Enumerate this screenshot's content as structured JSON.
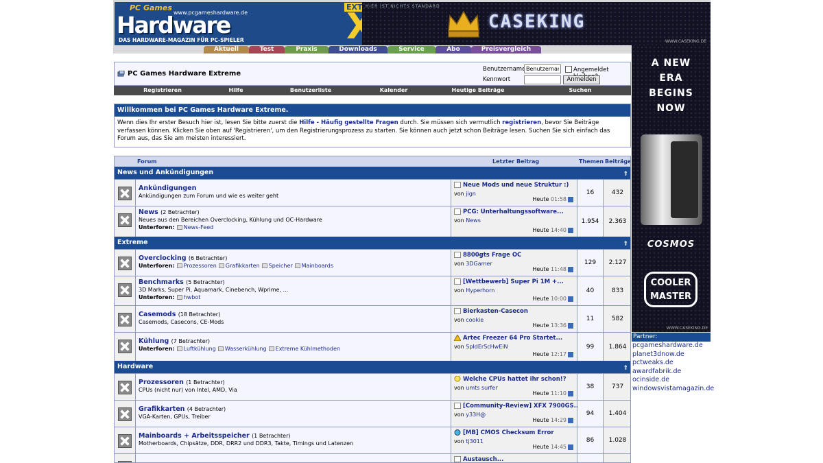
{
  "logo": {
    "brand": "Hardware",
    "pc": "PC Games",
    "edition": "EXTREME",
    "x": "X",
    "url": "www.pcgameshardware.de",
    "tagline": "DAS HARDWARE-MAGAZIN FÜR PC-SPIELER"
  },
  "banner": {
    "motto": "HIER IST NICHTS STANDARD",
    "brand": "CASEKING",
    "site": "WWW.CASEKING.DE"
  },
  "tabs": [
    {
      "label": "Aktuell",
      "color": "#b08850"
    },
    {
      "label": "Test",
      "color": "#a24855"
    },
    {
      "label": "Praxis",
      "color": "#6f9a4e"
    },
    {
      "label": "Downloads",
      "color": "#3f4d8f"
    },
    {
      "label": "Service",
      "color": "#689e4e"
    },
    {
      "label": "Abo",
      "color": "#5c4e97"
    },
    {
      "label": "Preisvergleich",
      "color": "#7a4f9a"
    }
  ],
  "header": {
    "title": "PC Games Hardware Extreme",
    "user_label": "Benutzername",
    "user_value": "Benutzername",
    "remember": "Angemeldet bleiben?",
    "pass_label": "Kennwort",
    "login": "Anmelden"
  },
  "menu": [
    "Registrieren",
    "Hilfe",
    "Benutzerliste",
    "Kalender",
    "Heutige Beiträge",
    "Suchen"
  ],
  "welcome": {
    "title": "Willkommen bei PC Games Hardware Extreme.",
    "p1": "Wenn dies Ihr erster Besuch hier ist, lesen Sie bitte zuerst die ",
    "faq": "Hilfe - Häufig gestellte Fragen",
    "p2": " durch. Sie müssen sich vermutlich ",
    "reg": "registrieren",
    "p3": ", bevor Sie Beiträge verfassen können. Klicken Sie oben auf 'Registrieren', um den Registrierungsprozess zu starten. Sie können auch jetzt schon Beiträge lesen. Suchen Sie sich einfach das Forum aus, das Sie am meisten interessiert."
  },
  "columns": {
    "forum": "Forum",
    "last": "Letzter Beitrag",
    "threads": "Themen",
    "posts": "Beiträge"
  },
  "categories": {
    "news": "News und Ankündigungen",
    "extreme": "Extreme",
    "hardware": "Hardware"
  },
  "collapse_glyph": "⇑",
  "labels": {
    "sub": "Unterforen:",
    "by": "von",
    "today": "Heute"
  },
  "forums": [
    {
      "name": "Ankündigungen",
      "viewers": "",
      "desc": "Ankündigungen zum Forum und wie es weiter geht",
      "subs": [],
      "last": "Neue Mods und neue Struktur :)",
      "by": "jign",
      "time": "01:58",
      "icon": "page",
      "threads": "16",
      "posts": "432"
    },
    {
      "name": "News",
      "viewers": "(2 Betrachter)",
      "desc": "Neues aus den Bereichen Overclocking, Kühlung und OC-Hardware",
      "subs": [
        "News-Feed"
      ],
      "last": "PCG: Unterhaltungssoftware...",
      "by": "News",
      "time": "14:40",
      "icon": "page",
      "threads": "1.954",
      "posts": "2.363"
    },
    {
      "name": "Overclocking",
      "viewers": "(6 Betrachter)",
      "desc": "",
      "subs": [
        "Prozessoren",
        "Grafikkarten",
        "Speicher",
        "Mainboards"
      ],
      "last": "8800gts Frage OC",
      "by": "3DGamer",
      "time": "11:48",
      "icon": "page",
      "threads": "129",
      "posts": "2.127"
    },
    {
      "name": "Benchmarks",
      "viewers": "(5 Betrachter)",
      "desc": "3D Marks, Super Pi, Aquamark, Cinebench, Wprime, ...",
      "subs": [
        "hwbot"
      ],
      "last": "[Wettbewerb] Super Pi 1M +...",
      "by": "Hyperhorn",
      "time": "10:00",
      "icon": "page",
      "threads": "40",
      "posts": "833"
    },
    {
      "name": "Casemods",
      "viewers": "(18 Betrachter)",
      "desc": "Casemods, Casecons, CE-Mods",
      "subs": [],
      "last": "Bierkasten-Casecon",
      "by": "cookie",
      "time": "13:36",
      "icon": "page",
      "threads": "11",
      "posts": "582"
    },
    {
      "name": "Kühlung",
      "viewers": "(7 Betrachter)",
      "desc": "",
      "subs": [
        "Luftkühlung",
        "Wasserkühlung",
        "Extreme Kühlmethoden"
      ],
      "last": "Artec Freezer 64 Pro Startet...",
      "by": "SpIdErScHwEiN",
      "time": "12:17",
      "icon": "warning",
      "threads": "99",
      "posts": "1.864"
    },
    {
      "name": "Prozessoren",
      "viewers": "(1 Betrachter)",
      "desc": "CPUs (nicht nur) von Intel, AMD, Via",
      "subs": [],
      "last": "Welche CPUs hattet ihr schon!?",
      "by": "umts surfer",
      "time": "11:10",
      "icon": "bulb",
      "threads": "38",
      "posts": "737"
    },
    {
      "name": "Grafikkarten",
      "viewers": "(4 Betrachter)",
      "desc": "VGA-Karten, GPUs, Treiber",
      "subs": [],
      "last": "[Community-Review] XFX 7900GS...",
      "by": "y33H@",
      "time": "14:29",
      "icon": "page",
      "threads": "94",
      "posts": "1.404"
    },
    {
      "name": "Mainboards + Arbeitsspeicher",
      "viewers": "(1 Betrachter)",
      "desc": "Motherboards, Chipsätze, DDR, DRR2 und DDR3, Takte, Timings und Latenzen",
      "subs": [],
      "last": "[MB] CMOS Checksum Error",
      "by": "tj3011",
      "time": "14:45",
      "icon": "smile",
      "threads": "86",
      "posts": "1.028"
    },
    {
      "name": "",
      "viewers": "",
      "desc": "",
      "subs": [],
      "last": "Austausch...",
      "by": "",
      "time": "",
      "icon": "page",
      "threads": "",
      "posts": ""
    }
  ],
  "sky": {
    "line1": "A NEW",
    "line2": "ERA",
    "line3": "BEGINS",
    "line4": "NOW",
    "cosmos": "COSMOS",
    "cm1": "COOLER",
    "cm2": "MASTER",
    "site": "WWW.CASEKING.DE"
  },
  "partners": {
    "title": "Partner:",
    "links": [
      "pcgameshardware.de",
      "planet3dnow.de",
      "pctweaks.de",
      "awardfabrik.de",
      "ocinside.de",
      "windowsvistamagazin.de"
    ]
  }
}
